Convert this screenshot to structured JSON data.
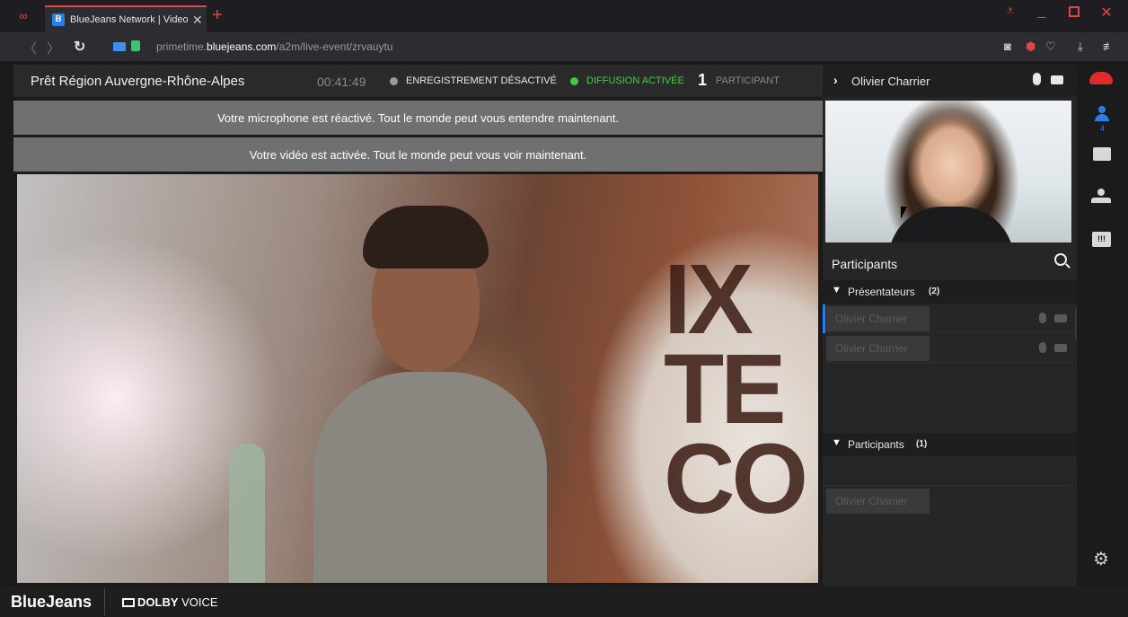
{
  "browser": {
    "tab_title": "BlueJeans Network | Video",
    "tab_favicon": "B",
    "tab_close": "✕",
    "new_tab": "+",
    "url_prefix": "primetime.",
    "url_domain": "bluejeans.com",
    "url_path": "/a2m/live-event/zrvauytu",
    "icons": [
      "browser-logo-icon",
      "back-icon",
      "forward-icon",
      "reload-icon",
      "camera-indicator-icon",
      "lock-icon",
      "snapshot-icon",
      "shield-icon",
      "heart-icon",
      "download-icon",
      "menu-icon"
    ]
  },
  "header": {
    "meeting_title": "Prêt Région Auvergne-Rhône-Alpes",
    "timer": "00:41:49",
    "recording_label": "ENREGISTREMENT DÉSACTIVÉ",
    "streaming_label": "DIFFUSION ACTIVÉE",
    "participant_count": "1",
    "participant_label": "PARTICIPANT",
    "colors": {
      "recording_dot": "#9a9a9a",
      "streaming": "#43c84b"
    }
  },
  "banners": {
    "mic": "Votre microphone est réactivé. Tout le monde peut vous entendre maintenant.",
    "video": "Votre vidéo est activée. Tout le monde peut vous voir maintenant."
  },
  "main_video": {
    "sign_text": "IX\nTE\nCO"
  },
  "right_panel": {
    "header_name": "Olivier Charrier",
    "participants_title": "Participants",
    "sections": [
      {
        "label": "Présentateurs",
        "count": "(2)",
        "rows": [
          {
            "name": "Olivier Charrier"
          },
          {
            "name": "Olivier Charrier"
          }
        ]
      },
      {
        "label": "Participants",
        "count": "(1)",
        "rows": [
          {
            "name": "Olivier Charrier"
          }
        ]
      }
    ]
  },
  "sidebar": {
    "people_count": "4",
    "qa_glyph": "!!!",
    "accent": "#2a7ee5",
    "hangup_color": "#e02b2b"
  },
  "footer": {
    "brand": "BlueJeans",
    "dolby_bold": "DOLBY",
    "dolby_light": " VOICE"
  }
}
